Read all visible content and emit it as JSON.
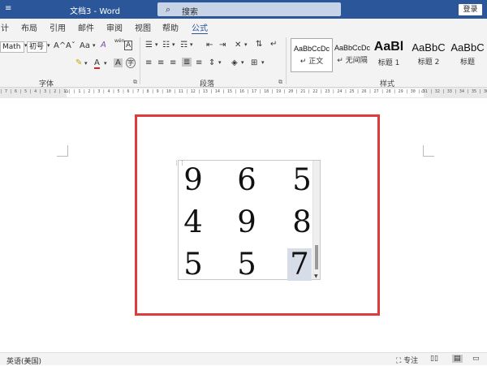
{
  "titlebar": {
    "qat_icon": "≡",
    "doc_title": "文档3  -  Word",
    "search_placeholder": "搜索",
    "login_label": "登录"
  },
  "tabs": [
    "计",
    "布局",
    "引用",
    "邮件",
    "审阅",
    "视图",
    "帮助",
    "公式"
  ],
  "ribbon": {
    "font_name": "Math",
    "font_size": "初号",
    "grow_font": "A^",
    "shrink_font": "Aˇ",
    "change_case": "Aa",
    "clear_format": "A",
    "phonetic": "wén",
    "char_border": "A",
    "highlight_icon": "highlight-pen-icon",
    "font_color_icon": "font-color-icon",
    "char_shading": "A",
    "enclosed_char": "字",
    "font_group_label": "字体",
    "paragraph_group_label": "段落",
    "styles_group_label": "样式",
    "styles": [
      {
        "sample": "AaBbCcDc",
        "name": "↵ 正文",
        "selected": true
      },
      {
        "sample": "AaBbCcDc",
        "name": "↵ 无间隔",
        "selected": false
      },
      {
        "sample": "AaBl",
        "name": "标题 1",
        "selected": false
      },
      {
        "sample": "AaBbC",
        "name": "标题 2",
        "selected": false
      },
      {
        "sample": "AaBbC",
        "name": "标题",
        "selected": false
      }
    ]
  },
  "ruler": {
    "ticks": "| 7 | 6 | 5 | 4 | 3 | 2 | 1 |   | 1 | 2 | 3 | 4 | 5 | 6 | 7 | 8 | 9 | 10 | 11 | 12 | 13 | 14 | 15 | 16 | 17 | 18 | 19 | 20 | 21 | 22 | 23 | 24 | 25 | 26 | 27 | 28 | 29 | 30 | 31 | 32 | 33 | 34 | 35 | 36 | 37 | 38 | 39 | 40 | 41 | 42 | 43 | 44 | 45 |"
  },
  "matrix": {
    "rows": [
      [
        "9",
        "6",
        "5"
      ],
      [
        "4",
        "9",
        "8"
      ],
      [
        "5",
        "5",
        "7"
      ]
    ],
    "selected_cell": "7"
  },
  "status": {
    "language": "英语(美国)",
    "focus_label": "专注"
  },
  "colors": {
    "title_bar": "#2b579a",
    "highlight_frame": "#e03a3a",
    "ribbon_bg": "#f3f3f3"
  }
}
